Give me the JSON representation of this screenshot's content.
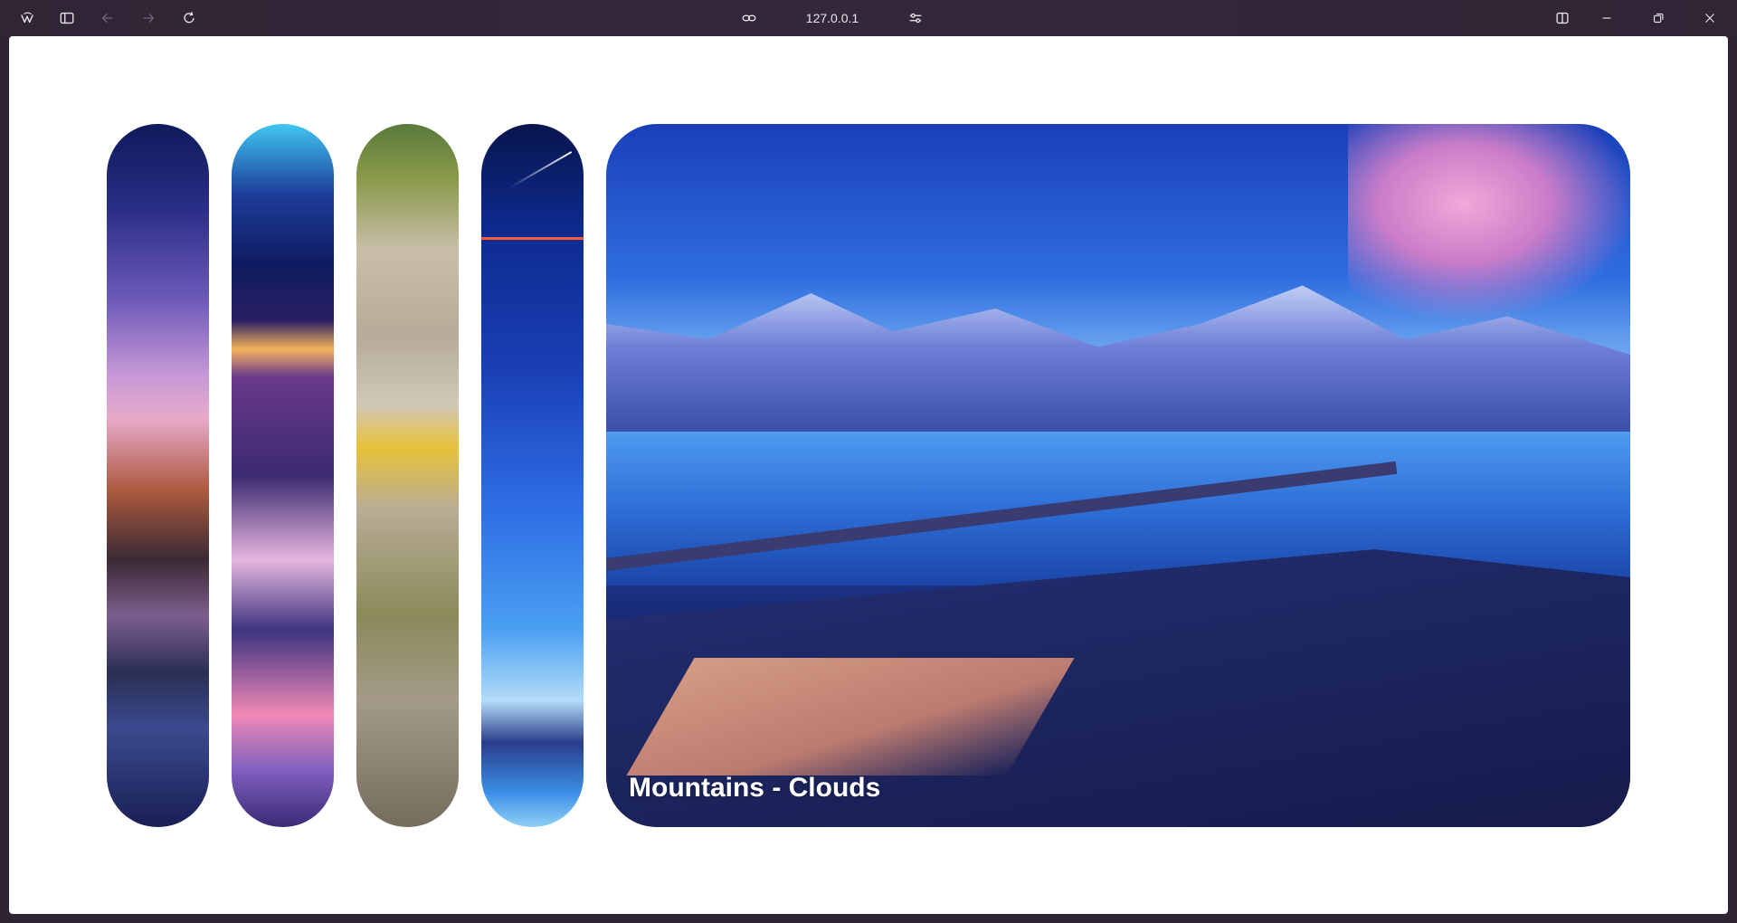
{
  "browser": {
    "url": "127.0.0.1",
    "icons": {
      "app": "app-logo-icon",
      "sidebar": "sidebar-toggle-icon",
      "back": "arrow-left-icon",
      "forward": "arrow-right-icon",
      "reload": "reload-icon",
      "link": "link-icon",
      "settings": "tune-icon",
      "split": "split-view-icon",
      "minimize": "minimize-icon",
      "restore": "restore-icon",
      "close": "close-icon"
    }
  },
  "gallery": {
    "panels": [
      {
        "name": "purple-sky-sunset"
      },
      {
        "name": "mountain-sunrise"
      },
      {
        "name": "dandelion"
      },
      {
        "name": "starry-night-girl"
      },
      {
        "name": "mountains-clouds",
        "caption": "Mountains - Clouds",
        "active": true
      }
    ]
  }
}
